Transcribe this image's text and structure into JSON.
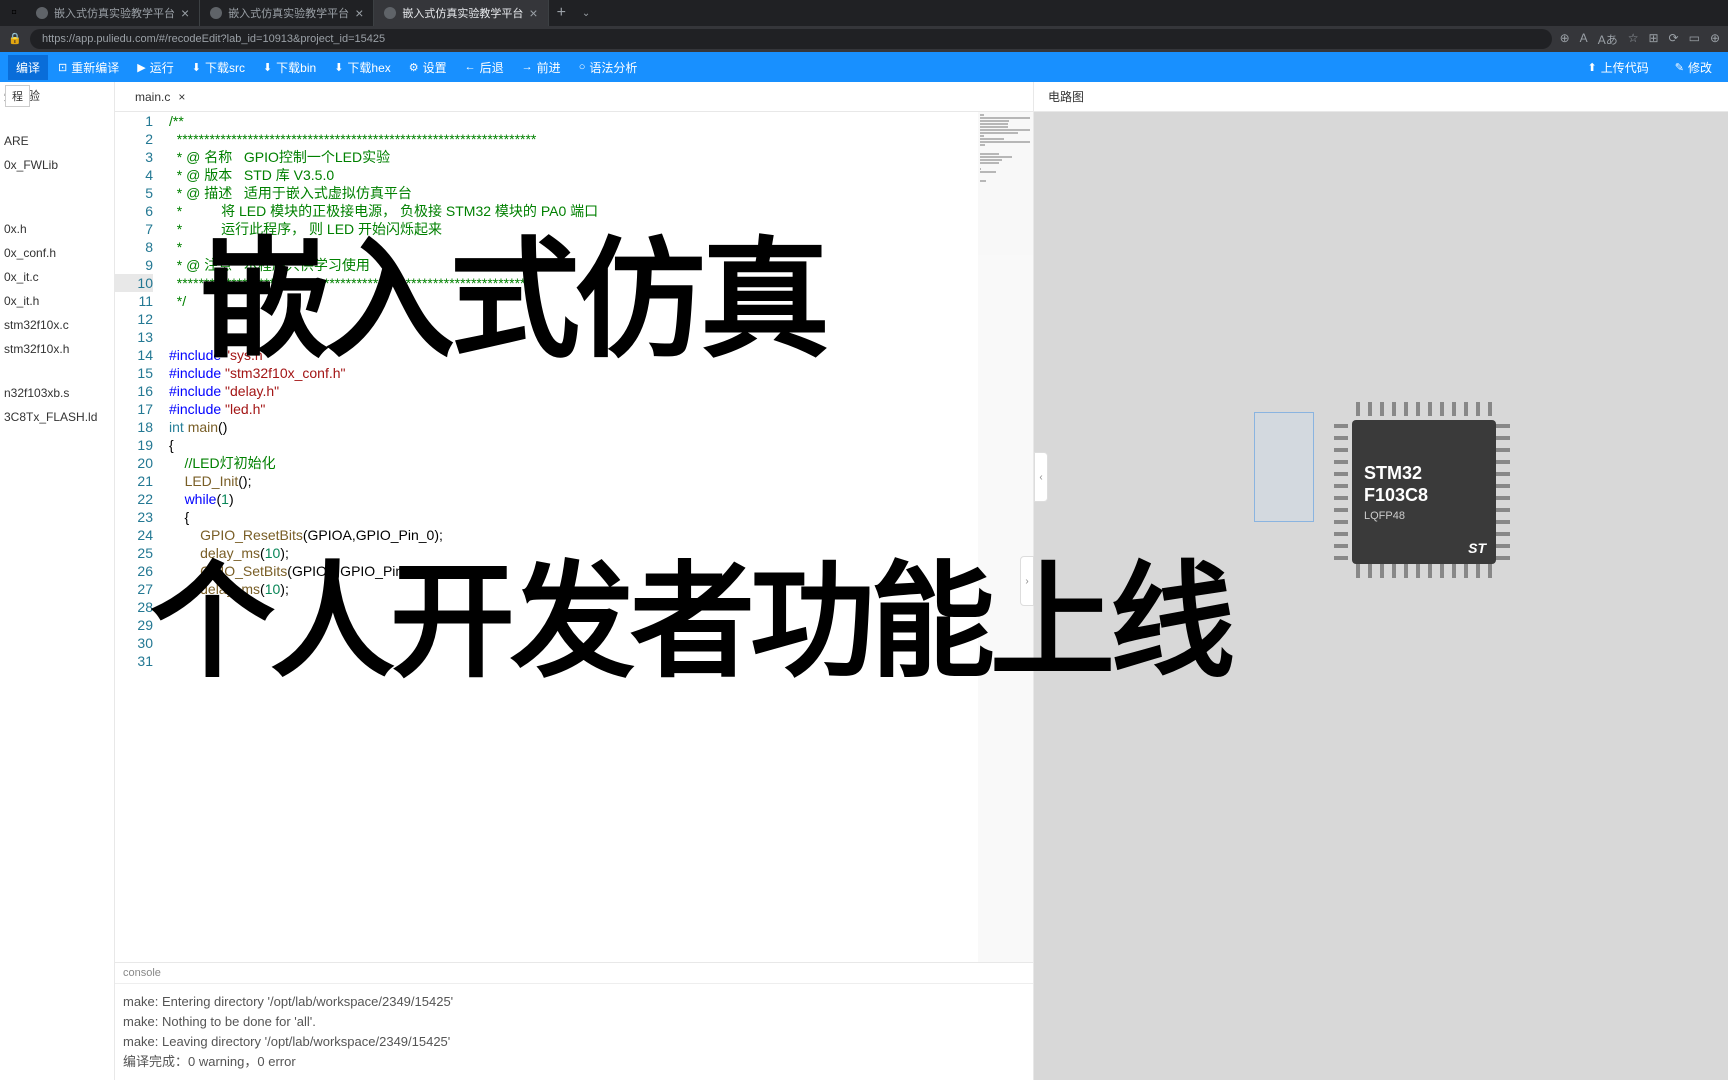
{
  "browser": {
    "tabs": [
      {
        "title": "嵌入式仿真实验教学平台",
        "active": false
      },
      {
        "title": "嵌入式仿真实验教学平台",
        "active": false
      },
      {
        "title": "嵌入式仿真实验教学平台",
        "active": true
      }
    ],
    "url": "https://app.puliedu.com/#/recodeEdit?lab_id=10913&project_id=15425"
  },
  "toolbar": {
    "compileBtn": "编译",
    "items": [
      {
        "icon": "⟳",
        "label": "重新编译"
      },
      {
        "icon": "▶",
        "label": "运行"
      },
      {
        "icon": "⬇",
        "label": "下载src"
      },
      {
        "icon": "⬇",
        "label": "下载bin"
      },
      {
        "icon": "⬇",
        "label": "下载hex"
      },
      {
        "icon": "⚙",
        "label": "设置"
      },
      {
        "icon": "←",
        "label": "后退"
      },
      {
        "icon": "→",
        "label": "前进"
      },
      {
        "icon": "○",
        "label": "语法分析"
      }
    ],
    "right": [
      {
        "icon": "⬆",
        "label": "上传代码"
      },
      {
        "icon": "✎",
        "label": "修改"
      }
    ]
  },
  "tooltip": "程",
  "sidebar": {
    "top": "炼实验",
    "items": [
      "ARE",
      "0x_FWLib"
    ],
    "files": [
      "0x.h",
      "0x_conf.h",
      "0x_it.c",
      "0x_it.h",
      "stm32f10x.c",
      "stm32f10x.h"
    ],
    "files2": [
      "n32f103xb.s",
      "3C8Tx_FLASH.ld"
    ]
  },
  "editor": {
    "filename": "main.c",
    "lines": [
      {
        "n": 1,
        "type": "comment",
        "text": "/**"
      },
      {
        "n": 2,
        "type": "comment",
        "text": "  ******************************************************************"
      },
      {
        "n": 3,
        "type": "comment",
        "text": "  * @ 名称   GPIO控制一个LED实验"
      },
      {
        "n": 4,
        "type": "comment",
        "text": "  * @ 版本   STD 库 V3.5.0"
      },
      {
        "n": 5,
        "type": "comment",
        "text": "  * @ 描述   适用于嵌入式虚拟仿真平台"
      },
      {
        "n": 6,
        "type": "comment",
        "text": "  *          将 LED 模块的正极接电源， 负极接 STM32 模块的 PA0 端口"
      },
      {
        "n": 7,
        "type": "comment",
        "text": "  *          运行此程序， 则 LED 开始闪烁起来"
      },
      {
        "n": 8,
        "type": "comment",
        "text": "  *"
      },
      {
        "n": 9,
        "type": "comment",
        "text": "  * @ 注意   本程序只供学习使用"
      },
      {
        "n": 10,
        "type": "comment",
        "text": "  ******************************************************************",
        "hl": true
      },
      {
        "n": 11,
        "type": "comment",
        "text": "  */"
      },
      {
        "n": 12,
        "type": "plain",
        "text": ""
      },
      {
        "n": 13,
        "type": "plain",
        "text": ""
      },
      {
        "n": 14,
        "type": "include",
        "text": "#include \"sys.h\""
      },
      {
        "n": 15,
        "type": "include",
        "text": "#include \"stm32f10x_conf.h\""
      },
      {
        "n": 16,
        "type": "include",
        "text": "#include \"delay.h\""
      },
      {
        "n": 17,
        "type": "include",
        "text": "#include \"led.h\""
      },
      {
        "n": 18,
        "type": "main",
        "kw": "int",
        "fn": "main",
        "rest": "()"
      },
      {
        "n": 19,
        "type": "plain",
        "text": "{"
      },
      {
        "n": 20,
        "type": "comment",
        "text": "    //LED灯初始化"
      },
      {
        "n": 21,
        "type": "call",
        "indent": "    ",
        "fn": "LED_Init",
        "rest": "();"
      },
      {
        "n": 22,
        "type": "while",
        "indent": "    ",
        "kw": "while",
        "num": "1",
        "rest": "()"
      },
      {
        "n": 23,
        "type": "plain",
        "text": "    {"
      },
      {
        "n": 24,
        "type": "call",
        "indent": "        ",
        "fn": "GPIO_ResetBits",
        "rest": "(GPIOA,GPIO_Pin_0);"
      },
      {
        "n": 25,
        "type": "callnum",
        "indent": "        ",
        "fn": "delay_ms",
        "num": "10",
        "rest": "();"
      },
      {
        "n": 26,
        "type": "call",
        "indent": "        ",
        "fn": "GPIO_SetBits",
        "rest": "(GPIOA,GPIO_Pin_0);"
      },
      {
        "n": 27,
        "type": "callnum",
        "indent": "        ",
        "fn": "delay_ms",
        "num": "10",
        "rest": "();"
      },
      {
        "n": 28,
        "type": "plain",
        "text": ""
      },
      {
        "n": 29,
        "type": "plain",
        "text": ""
      },
      {
        "n": 30,
        "type": "plain",
        "text": ""
      },
      {
        "n": 31,
        "type": "plain",
        "text": ""
      }
    ]
  },
  "console": {
    "title": "console",
    "lines": [
      "make: Entering directory '/opt/lab/workspace/2349/15425'",
      "make: Nothing to be done for 'all'.",
      "make: Leaving directory '/opt/lab/workspace/2349/15425'",
      "编译完成：0 warning，0 error"
    ]
  },
  "circuit": {
    "title": "电路图",
    "chip": {
      "line1": "STM32",
      "line2": "F103C8",
      "line3": "LQFP48",
      "logo": "ST"
    }
  },
  "overlay": {
    "text1": "嵌入式仿真",
    "text2": "个人开发者功能上线"
  }
}
